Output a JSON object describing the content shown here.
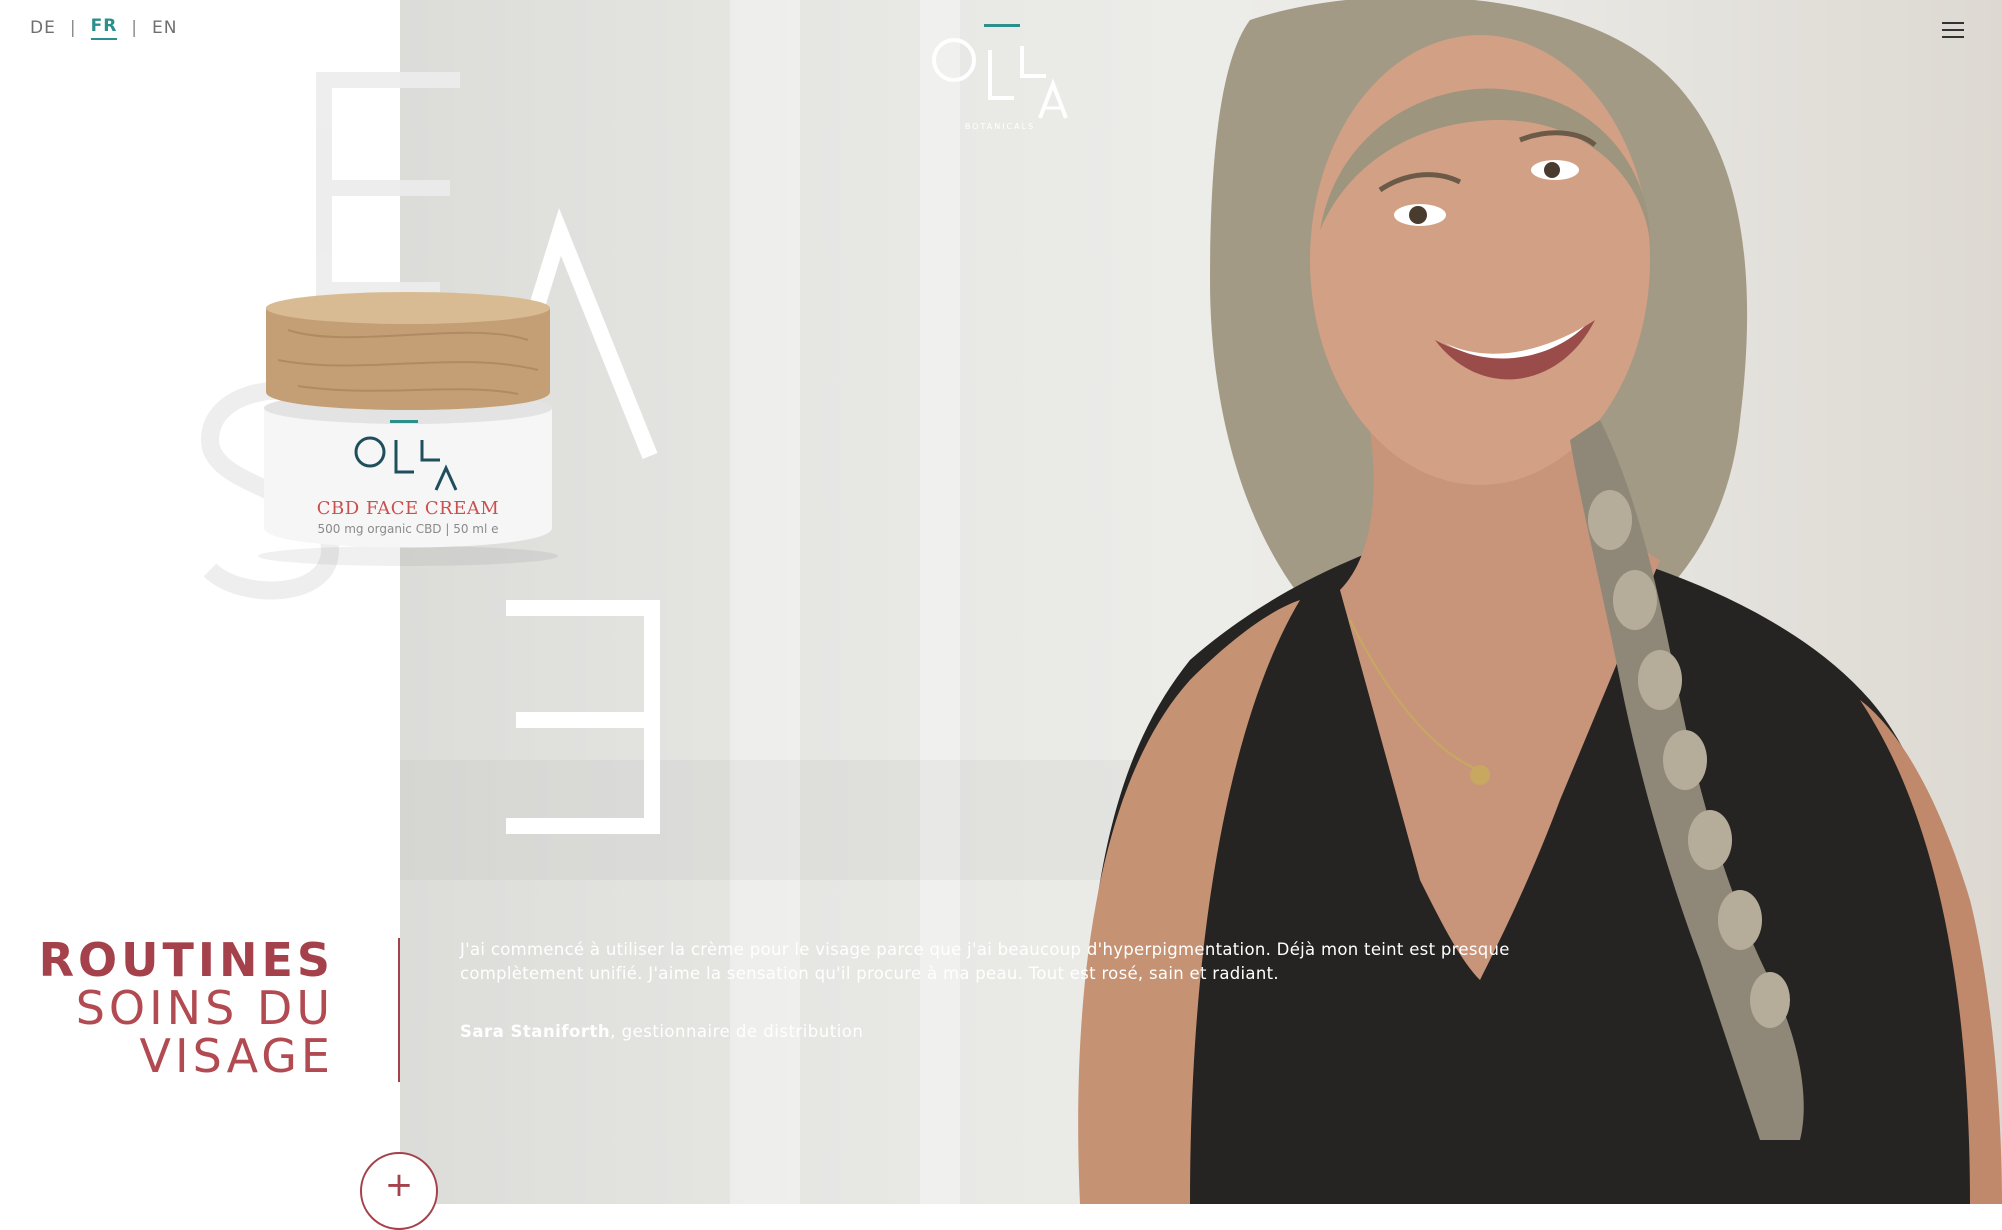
{
  "languages": {
    "de": "DE",
    "fr": "FR",
    "en": "EN",
    "separator": "|",
    "active": "FR"
  },
  "brand": {
    "name": "OLLA",
    "tagline": "BOTANICALS",
    "accent_color": "#2d8f8c"
  },
  "menu": {
    "icon": "hamburger-menu-icon"
  },
  "decorative_word": "EASE",
  "product": {
    "name": "CBD FACE CREAM",
    "details": "500 mg organic CBD | 50 ml e"
  },
  "section": {
    "title_line1": "ROUTINES",
    "title_line2": "SOINS DU",
    "title_line3": "VISAGE",
    "color": "#a4414a"
  },
  "testimonial": {
    "quote": "J'ai commencé à utiliser la crème pour le visage parce que j'ai beaucoup d'hyperpigmentation. Déjà mon teint est presque complètement unifié. J'aime la sensation qu'il procure à ma peau. Tout est rosé, sain et radiant.",
    "author_name": "Sara Staniforth",
    "author_role": ", gestionnaire de distribution"
  },
  "expand_button": {
    "label": "+",
    "icon": "plus-icon"
  }
}
